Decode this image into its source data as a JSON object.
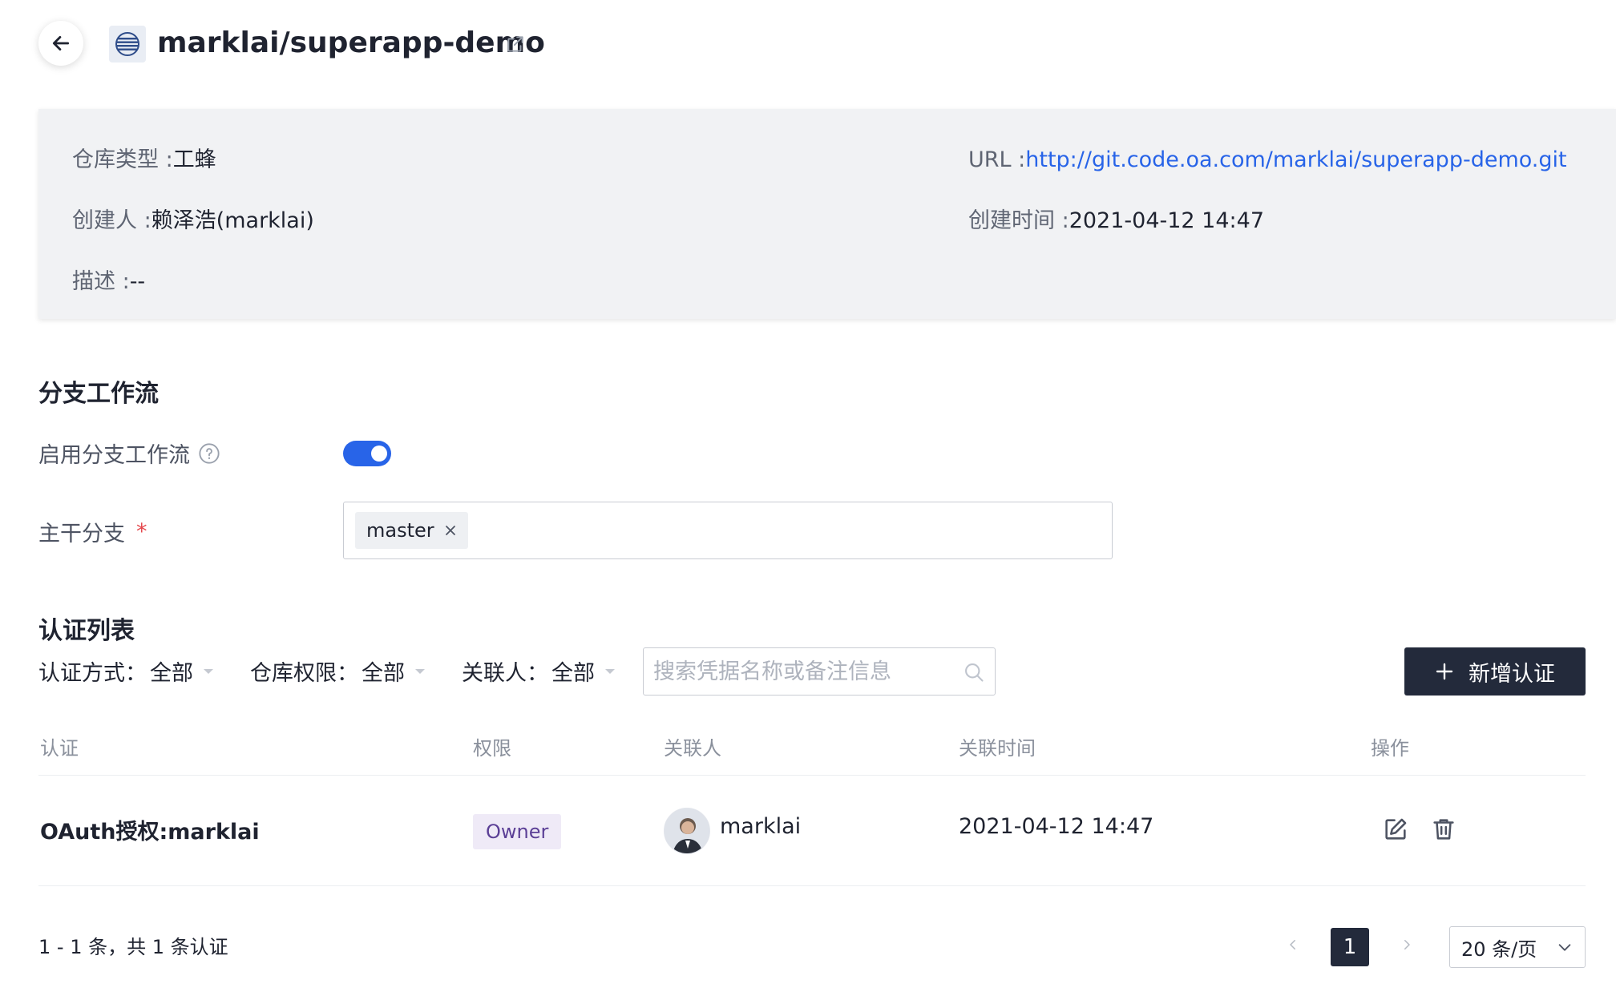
{
  "header": {
    "title": "marklai/superapp-demo"
  },
  "info": {
    "repo_type_label": "仓库类型 :",
    "repo_type_value": "工蜂",
    "url_label": "URL :",
    "url_value": "http://git.code.oa.com/marklai/superapp-demo.git",
    "creator_label": "创建人 :",
    "creator_value": "赖泽浩(marklai)",
    "created_time_label": "创建时间 :",
    "created_time_value": "2021-04-12 14:47",
    "desc_label": "描述 :",
    "desc_value": "--"
  },
  "branch_workflow": {
    "title": "分支工作流",
    "enable_label": "启用分支工作流",
    "enabled": true,
    "trunk_label": "主干分支",
    "trunk_tags": [
      "master"
    ]
  },
  "auth_list": {
    "title": "认证列表",
    "filters": [
      {
        "label": "认证方式：",
        "value": "全部"
      },
      {
        "label": "仓库权限：",
        "value": "全部"
      },
      {
        "label": "关联人：",
        "value": "全部"
      }
    ],
    "search_placeholder": "搜索凭据名称或备注信息",
    "add_button": "新增认证",
    "columns": [
      "认证",
      "权限",
      "关联人",
      "关联时间",
      "操作"
    ],
    "rows": [
      {
        "auth": "OAuth授权:marklai",
        "permission": "Owner",
        "user": "marklai",
        "time": "2021-04-12 14:47"
      }
    ]
  },
  "pagination": {
    "summary": "1 - 1 条，共 1 条认证",
    "current": "1",
    "page_size": "20 条/页"
  },
  "colors": {
    "primary": "#2864e8",
    "dark_button": "#232a3b",
    "panel_bg": "#f1f2f4",
    "badge_bg": "#efeaf7",
    "badge_text": "#5b3f96",
    "required": "#e5484d"
  }
}
